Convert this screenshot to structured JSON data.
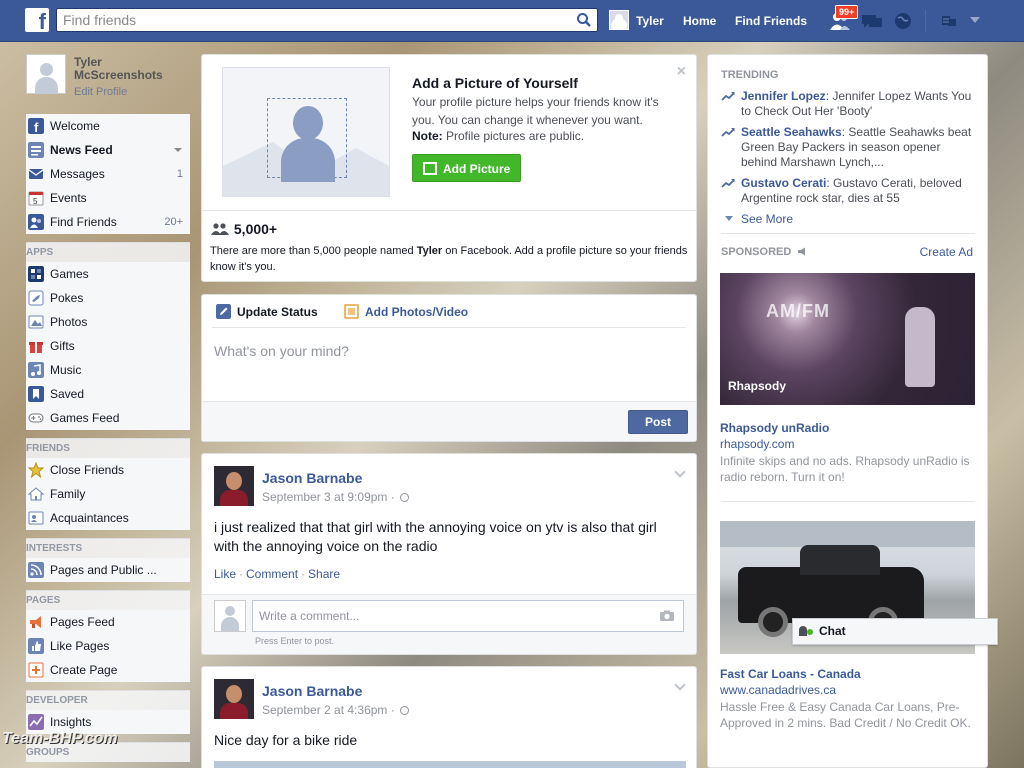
{
  "topbar": {
    "logo": "f",
    "search_placeholder": "Find friends",
    "user": "Tyler",
    "home": "Home",
    "find_friends": "Find Friends",
    "notification_badge": "99+"
  },
  "sidebar": {
    "profile": {
      "name": "Tyler McScreenshots",
      "edit": "Edit Profile"
    },
    "main": [
      {
        "label": "Welcome",
        "count": "",
        "color": "#3b5998"
      },
      {
        "label": "News Feed",
        "count": "",
        "color": "#6d84b4"
      },
      {
        "label": "Messages",
        "count": "1",
        "color": "#3b5998"
      },
      {
        "label": "Events",
        "count": "",
        "color": "#ffffff"
      },
      {
        "label": "Find Friends",
        "count": "20+",
        "color": "#3b5998"
      }
    ],
    "apps_header": "APPS",
    "apps": [
      "Games",
      "Pokes",
      "Photos",
      "Gifts",
      "Music",
      "Saved",
      "Games Feed"
    ],
    "friends_header": "FRIENDS",
    "friends": [
      "Close Friends",
      "Family",
      "Acquaintances"
    ],
    "interests_header": "INTERESTS",
    "interests": [
      "Pages and Public ..."
    ],
    "pages_header": "PAGES",
    "pages": [
      "Pages Feed",
      "Like Pages",
      "Create Page"
    ],
    "developer_header": "DEVELOPER",
    "developer": [
      "Insights"
    ],
    "groups_header": "GROUPS"
  },
  "add_picture": {
    "title": "Add a Picture of Yourself",
    "desc": "Your profile picture helps your friends know it's you. You can change it whenever you want.",
    "note_label": "Note:",
    "note_text": " Profile pictures are public.",
    "button": "Add Picture",
    "close": "×",
    "count": "5,000+",
    "info_prefix": "There are more than 5,000 people named ",
    "info_name": "Tyler",
    "info_suffix": " on Facebook. Add a profile picture so your friends know it's you."
  },
  "composer": {
    "tab_status": "Update Status",
    "tab_photos": "Add Photos/Video",
    "placeholder": "What's on your mind?",
    "post": "Post"
  },
  "stories": [
    {
      "author": "Jason Barnabe",
      "time": "September 3 at 9:09pm ·",
      "text": "i just realized that that girl with the annoying voice on ytv is also that girl with the annoying voice on the radio",
      "like": "Like",
      "comment": "Comment",
      "share": "Share",
      "comment_placeholder": "Write a comment...",
      "comment_hint": "Press Enter to post."
    },
    {
      "author": "Jason Barnabe",
      "time": "September 2 at 4:36pm ·",
      "text": "Nice day for a bike ride"
    }
  ],
  "trending": {
    "title": "TRENDING",
    "items": [
      {
        "name": "Jennifer Lopez",
        "desc": ": Jennifer Lopez Wants You to Check Out Her 'Booty'"
      },
      {
        "name": "Seattle Seahawks",
        "desc": ": Seattle Seahawks beat Green Bay Packers in season opener behind Marshawn Lynch,..."
      },
      {
        "name": "Gustavo Cerati",
        "desc": ": Gustavo Cerati, beloved Argentine rock star, dies at 55"
      }
    ],
    "see_more": "See More"
  },
  "sponsored": {
    "title": "SPONSORED",
    "create_ad": "Create Ad",
    "ads": [
      {
        "image_text": "AM/FM",
        "brand": "Rhapsody",
        "title": "Rhapsody unRadio",
        "url": "rhapsody.com",
        "desc": "Infinite skips and no ads. Rhapsody unRadio is radio reborn. Turn it on!"
      },
      {
        "title": "Fast Car Loans - Canada",
        "url": "www.canadadrives.ca",
        "desc": "Hassle Free & Easy Canada Car Loans, Pre-Approved in 2 mins. Bad Credit / No Credit OK."
      }
    ]
  },
  "chat": {
    "label": "Chat"
  },
  "watermark": "Team-BHP.com"
}
